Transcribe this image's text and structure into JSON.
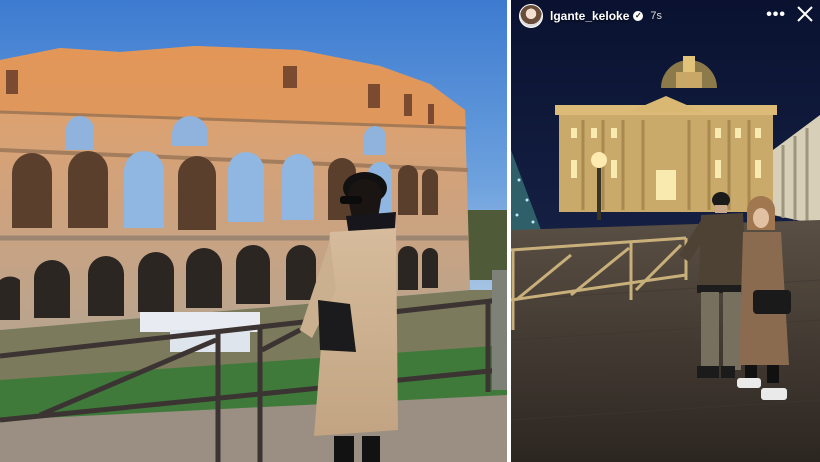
{
  "left_photo": {
    "description_icon": "colosseum-photo-icon"
  },
  "right_photo": {
    "description_icon": "st-peters-square-photo-icon"
  },
  "story": {
    "username": "lgante_keloke",
    "verified_icon": "verified-badge-icon",
    "verified_glyph": "✓",
    "time": "7s",
    "more_glyph": "•••",
    "more_icon": "more-options-icon",
    "close_icon": "close-icon"
  },
  "colors": {
    "divider": "#ffffff",
    "sky_left": "#3d7bd0",
    "sky_right": "#0d1530"
  }
}
